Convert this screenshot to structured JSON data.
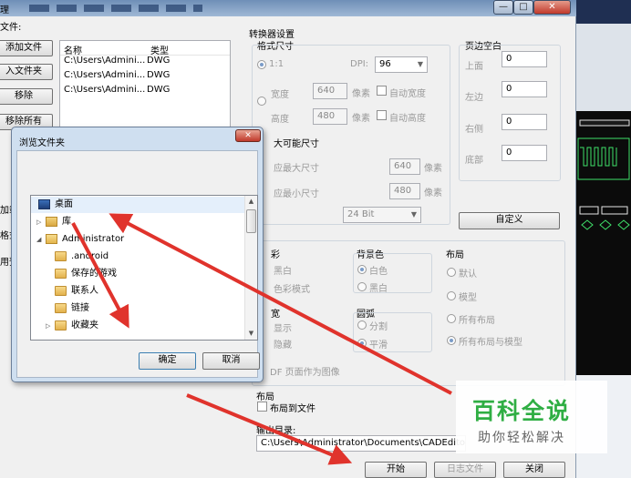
{
  "window": {
    "title": "理",
    "min_glyph": "—",
    "max_glyph": "□",
    "close_glyph": "✕"
  },
  "files": {
    "section_label": "文件:",
    "buttons": {
      "add_file": "添加文件",
      "add_folder": "入文件夹",
      "remove": "移除",
      "remove_all": "移除所有",
      "load": "加载",
      "format": "格式",
      "preview": "用预"
    },
    "columns": [
      "名称",
      "类型"
    ],
    "rows": [
      [
        "C:\\Users\\Admini...",
        "DWG"
      ],
      [
        "C:\\Users\\Admini...",
        "DWG"
      ],
      [
        "C:\\Users\\Admini...",
        "DWG"
      ]
    ]
  },
  "converter": {
    "title": "转换器设置",
    "format_size": "格式尺寸",
    "scale": "1:1",
    "dpi_label": "DPI:",
    "dpi_value": "96",
    "width_label": "宽度",
    "width_value": "640",
    "height_label": "高度",
    "height_value": "480",
    "pixel_unit": "像素",
    "auto_width": "自动宽度",
    "auto_height": "自动高度",
    "max_size": "大可能尺寸",
    "fit_max": "应最大尺寸",
    "fit_max_value": "640",
    "fit_min": "应最小尺寸",
    "fit_min_value": "480",
    "bit_depth": "24 Bit",
    "margins": {
      "title": "页边空白",
      "top_label": "上面",
      "top_value": "0",
      "left_label": "左边",
      "left_value": "0",
      "right_label": "右侧",
      "right_value": "0",
      "bottom_label": "底部",
      "bottom_value": "0"
    },
    "custom_button": "自定义"
  },
  "color": {
    "title": "彩",
    "bw": "黑白",
    "color_mode": "色彩模式"
  },
  "background": {
    "title": "背景色",
    "white": "白色",
    "black": "黑白"
  },
  "layout": {
    "title": "布局",
    "default": "默认",
    "model": "模型",
    "all_layouts": "所有布局",
    "all_layouts_model": "所有布局与模型"
  },
  "lineweight": {
    "title": "宽",
    "show": "显示",
    "hide": "隐藏"
  },
  "arc": {
    "title": "圆弧",
    "split": "分割",
    "smooth": "平滑"
  },
  "pdf_page": "DF 页面作为图像",
  "layout_section": {
    "title": "布局",
    "to_file": "布局到文件"
  },
  "output": {
    "title": "输出目录:",
    "path": "C:\\Users\\Administrator\\Documents\\CADEditor"
  },
  "actions": {
    "start": "开始",
    "log": "日志文件",
    "close": "关闭"
  },
  "dialog": {
    "title": "浏览文件夹",
    "close_glyph": "✕",
    "tree": [
      {
        "label": "桌面",
        "icon": "desktop-icon",
        "level": 0,
        "toggle": ""
      },
      {
        "label": "库",
        "icon": "library-icon",
        "level": 1,
        "toggle": "▷"
      },
      {
        "label": "Administrator",
        "icon": "user-folder-icon",
        "level": 1,
        "toggle": "◢"
      },
      {
        "label": ".android",
        "icon": "folder-icon",
        "level": 2,
        "toggle": ""
      },
      {
        "label": "保存的游戏",
        "icon": "folder-icon",
        "level": 2,
        "toggle": ""
      },
      {
        "label": "联系人",
        "icon": "folder-icon",
        "level": 2,
        "toggle": ""
      },
      {
        "label": "链接",
        "icon": "folder-icon",
        "level": 2,
        "toggle": ""
      },
      {
        "label": "收藏夹",
        "icon": "folder-icon",
        "level": 2,
        "toggle": "▷"
      }
    ],
    "ok": "确定",
    "cancel": "取消"
  },
  "watermark": {
    "title": "百科全说",
    "subtitle": "助你轻松解决"
  },
  "colors": {
    "arrow": "#e0332c",
    "accent": "#2fae43"
  }
}
